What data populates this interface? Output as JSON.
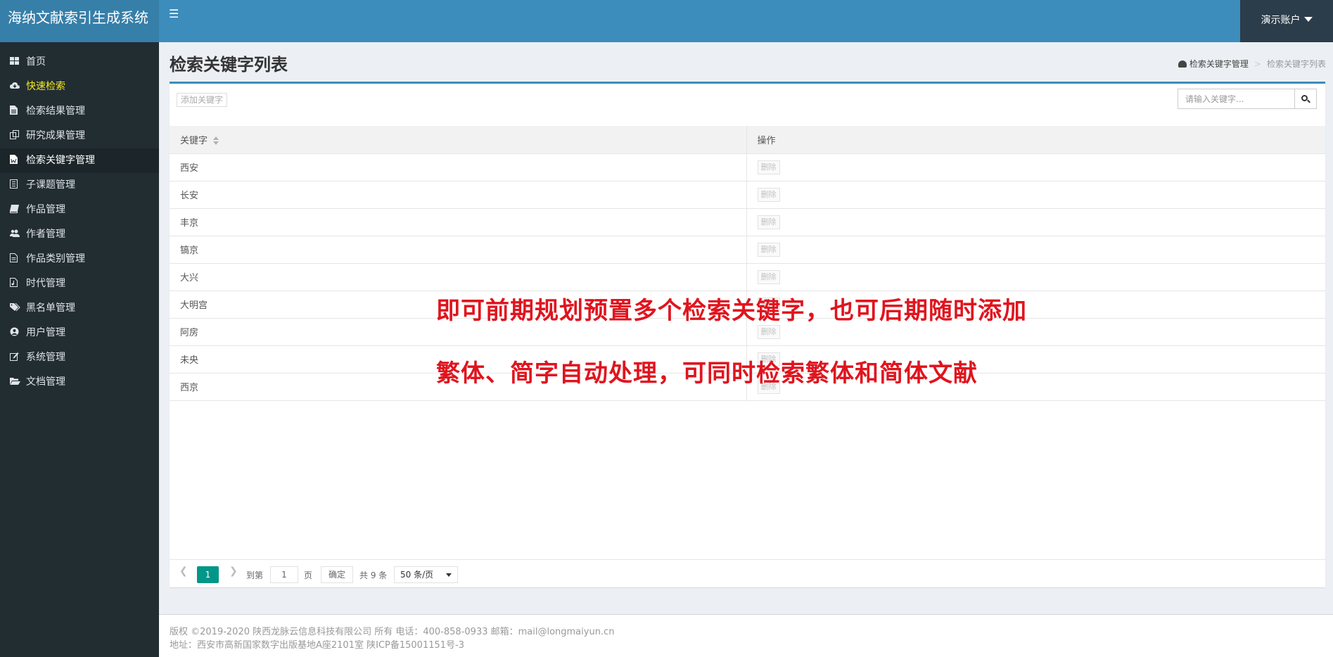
{
  "app": {
    "title": "海纳文献索引生成系统"
  },
  "header": {
    "account_label": "演示账户"
  },
  "sidebar": {
    "items": [
      {
        "label": "首页",
        "icon": "dashboard-icon"
      },
      {
        "label": "快速检索",
        "icon": "cloud-icon"
      },
      {
        "label": "检索结果管理",
        "icon": "file-icon"
      },
      {
        "label": "研究成果管理",
        "icon": "copy-icon"
      },
      {
        "label": "检索关键字管理",
        "icon": "word-file-icon"
      },
      {
        "label": "子课题管理",
        "icon": "notebook-icon"
      },
      {
        "label": "作品管理",
        "icon": "book-icon"
      },
      {
        "label": "作者管理",
        "icon": "users-icon"
      },
      {
        "label": "作品类别管理",
        "icon": "document-icon"
      },
      {
        "label": "时代管理",
        "icon": "audio-file-icon"
      },
      {
        "label": "黑名单管理",
        "icon": "tags-icon"
      },
      {
        "label": "用户管理",
        "icon": "user-circle-icon"
      },
      {
        "label": "系统管理",
        "icon": "edit-icon"
      },
      {
        "label": "文档管理",
        "icon": "folder-open-icon"
      }
    ]
  },
  "page": {
    "title": "检索关键字列表"
  },
  "breadcrumb": {
    "home": "检索关键字管理",
    "current": "检索关键字列表"
  },
  "toolbar": {
    "add_label": "添加关键字",
    "search_placeholder": "请输入关键字..."
  },
  "table": {
    "headers": {
      "keyword": "关键字",
      "action": "操作"
    },
    "rows": [
      {
        "keyword": "西安",
        "action": "删除"
      },
      {
        "keyword": "长安",
        "action": "删除"
      },
      {
        "keyword": "丰京",
        "action": "删除"
      },
      {
        "keyword": "镐京",
        "action": "删除"
      },
      {
        "keyword": "大兴",
        "action": "删除"
      },
      {
        "keyword": "大明宫",
        "action": "删除"
      },
      {
        "keyword": "阿房",
        "action": "删除"
      },
      {
        "keyword": "未央",
        "action": "删除"
      },
      {
        "keyword": "西京",
        "action": "删除"
      }
    ]
  },
  "pagination": {
    "current_page": "1",
    "goto_label": "到第",
    "goto_value": "1",
    "page_unit": "页",
    "confirm_label": "确定",
    "total_label": "共 9 条",
    "page_size_label": "50 条/页"
  },
  "overlay": {
    "line1": "即可前期规划预置多个检索关键字，也可后期随时添加",
    "line2": "繁体、简字自动处理，可同时检索繁体和简体文献"
  },
  "footer": {
    "line1": "版权 ©2019-2020 陕西龙脉云信息科技有限公司 所有   电话：400-858-0933  邮箱：mail@longmaiyun.cn",
    "line2": "地址：西安市高新国家数字出版基地A座2101室   陕ICP备15001151号-3"
  },
  "colors": {
    "header_bg": "#3c8dbc",
    "logo_bg": "#367fa9",
    "sidebar_bg": "#222d32",
    "highlight_text": "#f4ea1e",
    "pager_active": "#009688",
    "overlay_text": "#e0141e"
  }
}
